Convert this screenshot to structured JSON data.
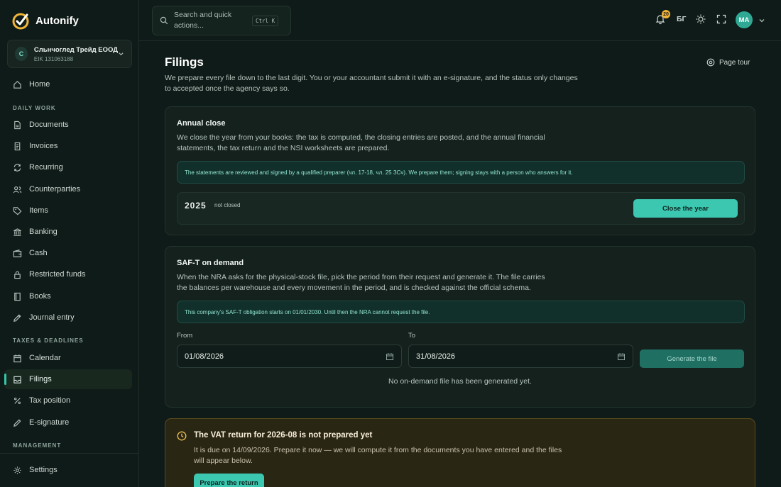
{
  "app": {
    "name": "Autonify"
  },
  "company": {
    "initial": "C",
    "name": "Сльнчоглед Трейд ЕООД",
    "eik": "EIK 131063188"
  },
  "search": {
    "placeholder": "Search and quick actions...",
    "shortcut": "Ctrl K"
  },
  "topbar": {
    "notifications": "20",
    "language": "БГ",
    "user_initials": "MA"
  },
  "nav": {
    "home": "Home",
    "section_daily": "DAILY WORK",
    "documents": "Documents",
    "invoices": "Invoices",
    "recurring": "Recurring",
    "counterparties": "Counterparties",
    "items": "Items",
    "banking": "Banking",
    "cash": "Cash",
    "restricted": "Restricted funds",
    "books": "Books",
    "journal": "Journal entry",
    "section_taxes": "TAXES & DEADLINES",
    "calendar": "Calendar",
    "filings": "Filings",
    "tax_position": "Tax position",
    "esignature": "E-signature",
    "section_management": "MANAGEMENT",
    "settings": "Settings"
  },
  "page": {
    "title": "Filings",
    "description": "We prepare every file down to the last digit. You or your accountant submit it with an e-signature, and the status only changes to accepted once the agency says so.",
    "tour": "Page tour"
  },
  "annual": {
    "title": "Annual close",
    "description": "We close the year from your books: the tax is computed, the closing entries are posted, and the annual financial statements, the tax return and the NSI worksheets are prepared.",
    "note": "The statements are reviewed and signed by a qualified preparer (чл. 17-18, чл. 25 ЗСч). We prepare them; signing stays with a person who answers for it.",
    "year": "2025",
    "status": "not closed",
    "button": "Close the year"
  },
  "saft": {
    "title": "SAF-T on demand",
    "description": "When the NRA asks for the physical-stock file, pick the period from their request and generate it. The file carries the balances per warehouse and every movement in the period, and is checked against the official schema.",
    "note": "This company's SAF-T obligation starts on 01/01/2030. Until then the NRA cannot request the file.",
    "from_label": "From",
    "to_label": "To",
    "from_value": "01/08/2026",
    "to_value": "31/08/2026",
    "button": "Generate the file",
    "empty": "No on-demand file has been generated yet."
  },
  "vat": {
    "title": "The VAT return for 2026-08 is not prepared yet",
    "description": "It is due on 14/09/2026. Prepare it now — we will compute it from the documents you have entered and the files will appear below.",
    "button": "Prepare the return"
  },
  "colors": {
    "accent": "#3cc8b0",
    "warning_bg": "#2a2614",
    "warning_border": "#5b4b1d"
  }
}
